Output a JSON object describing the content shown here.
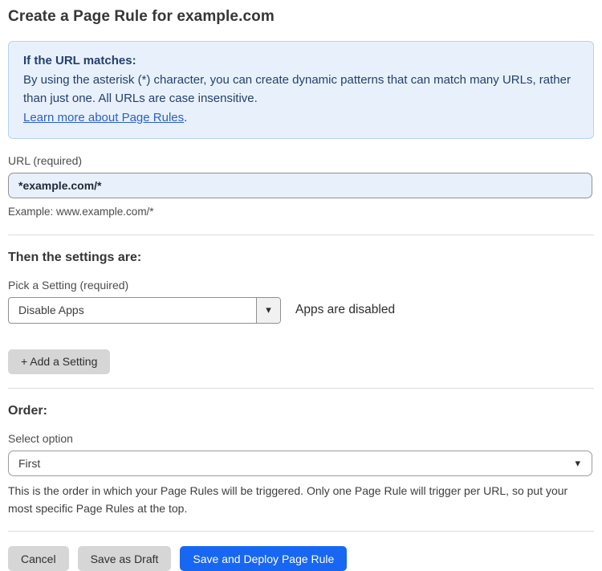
{
  "header": {
    "title": "Create a Page Rule for example.com"
  },
  "info_box": {
    "heading": "If the URL matches:",
    "body": "By using the asterisk (*) character, you can create dynamic patterns that can match many URLs, rather than just one. All URLs are case insensitive.",
    "link_label": "Learn more about Page Rules",
    "link_suffix": "."
  },
  "url_section": {
    "label": "URL (required)",
    "value": "*example.com/*",
    "helper": "Example: www.example.com/*"
  },
  "settings_section": {
    "heading": "Then the settings are:",
    "picker_label": "Pick a Setting (required)",
    "selected_setting": "Disable Apps",
    "caret_icon": "▾",
    "status_text": "Apps are disabled",
    "add_button_label": "+ Add a Setting"
  },
  "order_section": {
    "heading": "Order:",
    "select_label": "Select option",
    "selected_option": "First",
    "caret_icon": "▾",
    "helper": "This is the order in which your Page Rules will be triggered. Only one Page Rule will trigger per URL, so put your most specific Page Rules at the top."
  },
  "footer": {
    "cancel_label": "Cancel",
    "save_draft_label": "Save as Draft",
    "save_deploy_label": "Save and Deploy Page Rule"
  },
  "colors": {
    "info_bg": "#e8f1fb",
    "info_border": "#b5d3ee",
    "info_text": "#24406f",
    "link_blue": "#2c5fc7",
    "input_bg": "#e8f0fb",
    "primary_button_blue": "#1767f2",
    "secondary_button_gray": "#d6d6d6"
  }
}
